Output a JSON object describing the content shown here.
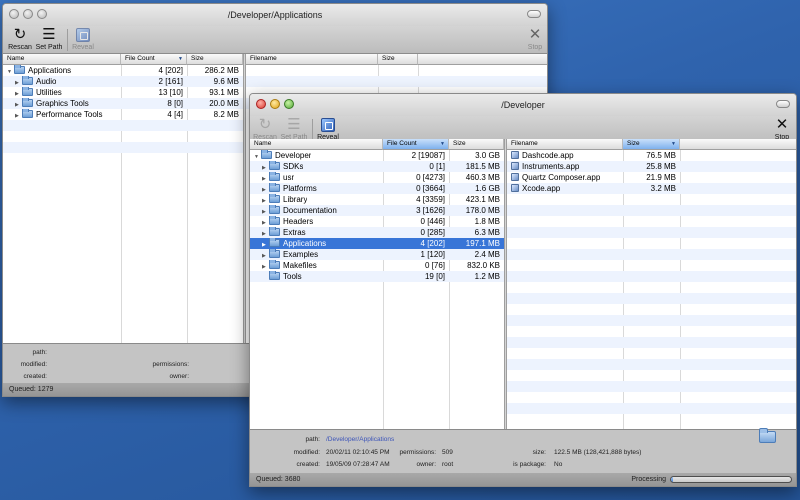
{
  "back_window": {
    "title": "/Developer/Applications",
    "toolbar": {
      "rescan": "Rescan",
      "set_path": "Set Path",
      "reveal": "Reveal",
      "stop": "Stop"
    },
    "columns": {
      "name": "Name",
      "file_count": "File Count",
      "size": "Size",
      "filename": "Filename",
      "size2": "Size"
    },
    "rows": [
      {
        "name": "Applications",
        "count": "4  [202]",
        "size": "286.2 MB"
      },
      {
        "name": "Audio",
        "count": "2  [161]",
        "size": "9.6 MB"
      },
      {
        "name": "Utilities",
        "count": "13  [10]",
        "size": "93.1 MB"
      },
      {
        "name": "Graphics Tools",
        "count": "8  [0]",
        "size": "20.0 MB"
      },
      {
        "name": "Performance Tools",
        "count": "4  [4]",
        "size": "8.2 MB"
      }
    ],
    "info": {
      "path_label": "path:",
      "modified_label": "modified:",
      "created_label": "created:",
      "permissions_label": "permissions:",
      "owner_label": "owner:"
    },
    "status": "Queued: 1279"
  },
  "front_window": {
    "title": "/Developer",
    "toolbar": {
      "rescan": "Rescan",
      "set_path": "Set Path",
      "reveal": "Reveal",
      "stop": "Stop"
    },
    "columns": {
      "name": "Name",
      "file_count": "File Count",
      "size": "Size",
      "filename": "Filename",
      "size2": "Size"
    },
    "rows": [
      {
        "name": "Developer",
        "count": "2  [19087]",
        "size": "3.0 GB"
      },
      {
        "name": "SDKs",
        "count": "0  [1]",
        "size": "181.5 MB"
      },
      {
        "name": "usr",
        "count": "0  [4273]",
        "size": "460.3 MB"
      },
      {
        "name": "Platforms",
        "count": "0  [3664]",
        "size": "1.6 GB"
      },
      {
        "name": "Library",
        "count": "4  [3359]",
        "size": "423.1 MB"
      },
      {
        "name": "Documentation",
        "count": "3  [1626]",
        "size": "178.0 MB"
      },
      {
        "name": "Headers",
        "count": "0  [446]",
        "size": "1.8 MB"
      },
      {
        "name": "Extras",
        "count": "0  [285]",
        "size": "6.3 MB"
      },
      {
        "name": "Applications",
        "count": "4  [202]",
        "size": "197.1 MB"
      },
      {
        "name": "Examples",
        "count": "1  [120]",
        "size": "2.4 MB"
      },
      {
        "name": "Makefiles",
        "count": "0  [76]",
        "size": "832.0 KB"
      },
      {
        "name": "Tools",
        "count": "19  [0]",
        "size": "1.2 MB"
      }
    ],
    "files": [
      {
        "name": "Dashcode.app",
        "size": "76.5 MB"
      },
      {
        "name": "Instruments.app",
        "size": "25.8 MB"
      },
      {
        "name": "Quartz Composer.app",
        "size": "21.9 MB"
      },
      {
        "name": "Xcode.app",
        "size": "3.2 MB"
      }
    ],
    "info": {
      "path_label": "path:",
      "path": "/Developer/Applications",
      "modified_label": "modified:",
      "modified": "20/02/11 02:10:45 PM",
      "created_label": "created:",
      "created": "19/05/09 07:28:47 AM",
      "permissions_label": "permissions:",
      "permissions": "509",
      "owner_label": "owner:",
      "owner": "root",
      "size_label": "size:",
      "size": "122.5 MB  (128,421,888 bytes)",
      "is_package_label": "is package:",
      "is_package": "No"
    },
    "status": "Queued: 3680",
    "processing": "Processing",
    "progress": 0.02
  }
}
